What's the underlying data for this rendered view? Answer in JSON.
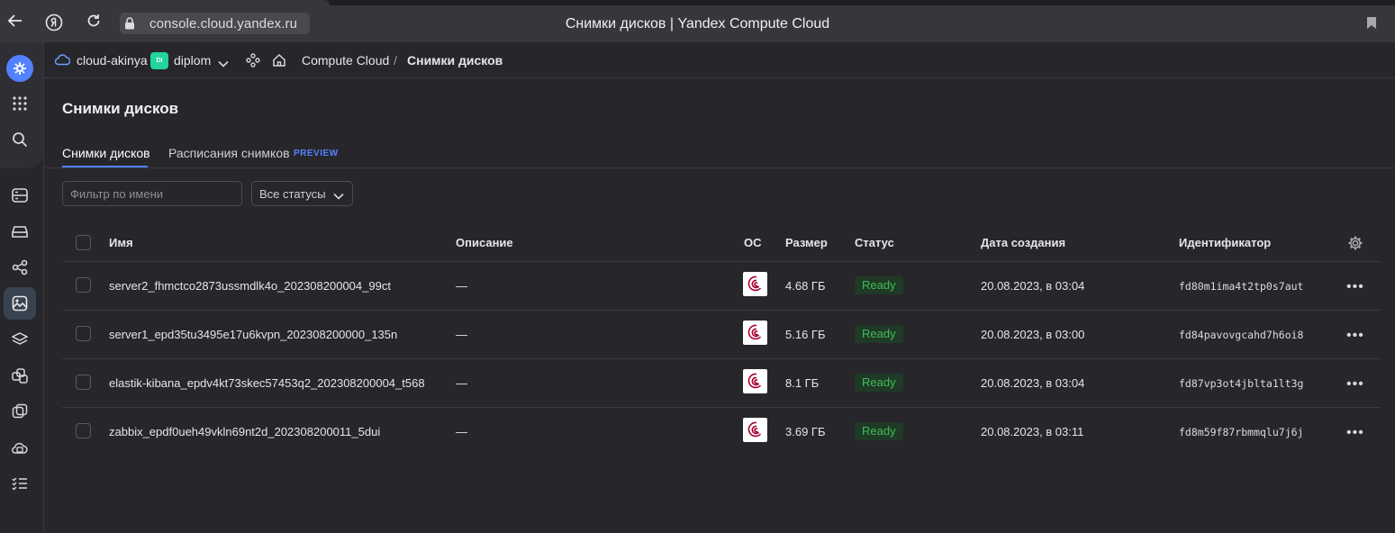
{
  "browser": {
    "url": "console.cloud.yandex.ru",
    "window_title": "Снимки дисков | Yandex Compute Cloud"
  },
  "topbar": {
    "cloud_name": "cloud-akinya",
    "folder_badge": "DI",
    "folder_name": "diplom",
    "breadcrumb_service": "Compute Cloud",
    "breadcrumb_separator": "/",
    "breadcrumb_current": "Снимки дисков"
  },
  "page": {
    "title": "Снимки дисков",
    "tabs": [
      {
        "label": "Снимки дисков",
        "active": true
      },
      {
        "label": "Расписания снимков",
        "active": false
      }
    ],
    "preview_label": "PREVIEW"
  },
  "filters": {
    "name_placeholder": "Фильтр по имени",
    "status_value": "Все статусы"
  },
  "table": {
    "columns": [
      "Имя",
      "Описание",
      "ОС",
      "Размер",
      "Статус",
      "Дата создания",
      "Идентификатор"
    ],
    "rows": [
      {
        "name": "server2_fhmctco2873ussmdlk4o_202308200004_99ct",
        "description": "—",
        "os": "debian",
        "size": "4.68 ГБ",
        "status": "Ready",
        "created": "20.08.2023, в 03:04",
        "id": "fd80m1ima4t2tp0s7aut"
      },
      {
        "name": "server1_epd35tu3495e17u6kvpn_202308200000_135n",
        "description": "—",
        "os": "debian",
        "size": "5.16 ГБ",
        "status": "Ready",
        "created": "20.08.2023, в 03:00",
        "id": "fd84pavovgcahd7h6oi8"
      },
      {
        "name": "elastik-kibana_epdv4kt73skec57453q2_202308200004_t568",
        "description": "—",
        "os": "debian",
        "size": "8.1 ГБ",
        "status": "Ready",
        "created": "20.08.2023, в 03:04",
        "id": "fd87vp3ot4jblta1lt3g"
      },
      {
        "name": "zabbix_epdf0ueh49vkln69nt2d_202308200011_5dui",
        "description": "—",
        "os": "debian",
        "size": "3.69 ГБ",
        "status": "Ready",
        "created": "20.08.2023, в 03:11",
        "id": "fd8m59f87rbmmqlu7j6j"
      }
    ]
  },
  "colors": {
    "accent": "#5282ff",
    "status_ready": "#3fbc57",
    "folder_badge": "#22d3a0",
    "background": "#27262b"
  },
  "icons": {
    "sidebar": [
      "yandex-cloud-logo-icon",
      "apps-grid-icon",
      "search-icon",
      "vm-icon",
      "disk-icon",
      "placement-groups-icon",
      "snapshots-icon",
      "images-icon",
      "instance-groups-icon",
      "gpu-clusters-icon",
      "file-storage-icon",
      "operations-icon"
    ]
  }
}
